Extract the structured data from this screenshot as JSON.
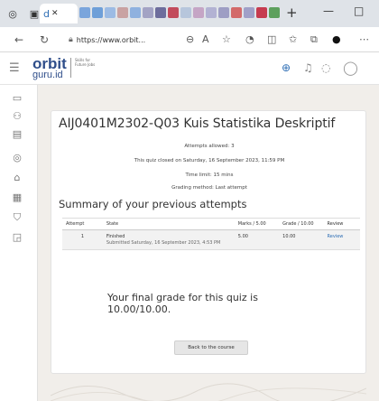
{
  "browser": {
    "tab_label": "d",
    "url": "https://www.orbit...",
    "new_tab_icon": "plus-icon"
  },
  "site": {
    "logo_text": "orbit",
    "logo_sub": "guru.id",
    "logo_tagline": "Skills for Future Jobs"
  },
  "quiz": {
    "title": "AIJ0401M2302-Q03 Kuis Statistika Deskriptif",
    "attempts_allowed": "Attempts allowed: 3",
    "closed": "This quiz closed on Saturday, 16 September 2023, 11:59 PM",
    "time_limit": "Time limit: 15 mins",
    "grading_method": "Grading method: Last attempt"
  },
  "summary": {
    "title": "Summary of your previous attempts",
    "columns": [
      "Attempt",
      "State",
      "Marks / 5.00",
      "Grade / 10.00",
      "Review"
    ],
    "rows": [
      {
        "attempt": "1",
        "state": "Finished",
        "submitted": "Submitted Saturday, 16 September 2023, 4:53 PM",
        "marks": "5.00",
        "grade": "10.00",
        "review": "Review"
      }
    ]
  },
  "final_grade": "Your final grade for this quiz is 10.00/10.00.",
  "back_button": "Back to the course",
  "colors": {
    "brand": "#2f4e8a",
    "link": "#2f6fb5",
    "tab_bar": "#dfe3e8"
  }
}
